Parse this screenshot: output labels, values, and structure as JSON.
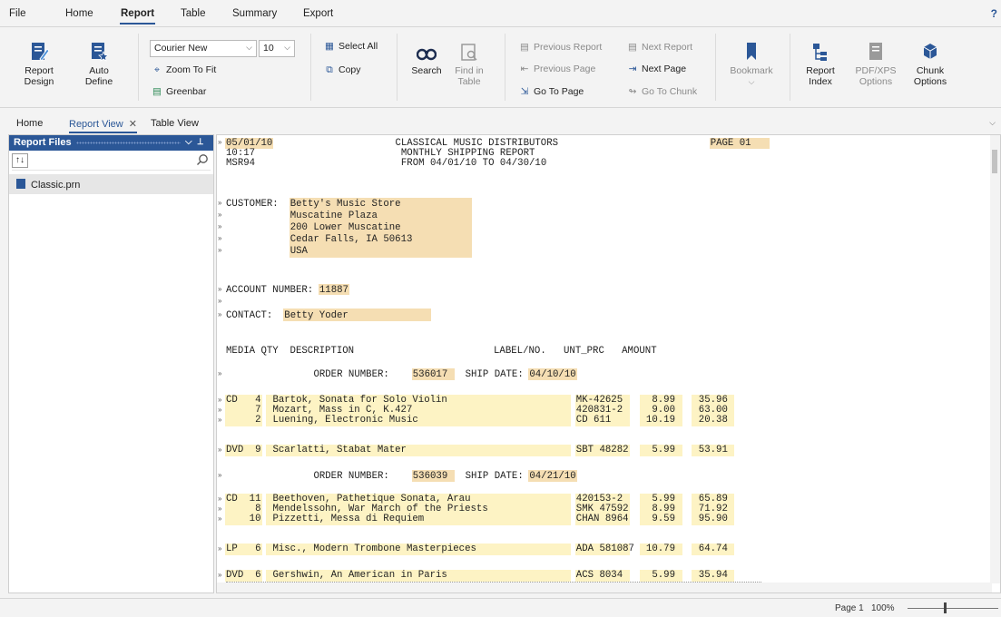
{
  "menu": {
    "items": [
      "File",
      "Home",
      "Report",
      "Table",
      "Summary",
      "Export"
    ],
    "active": "Report",
    "help": "?"
  },
  "ribbon": {
    "report_design": "Report\nDesign",
    "auto_define": "Auto\nDefine",
    "font_name": "Courier New",
    "font_size": "10",
    "zoom_to_fit": "Zoom To Fit",
    "greenbar": "Greenbar",
    "select_all": "Select All",
    "copy": "Copy",
    "search": "Search",
    "find_in_table": "Find in\nTable",
    "previous_report": "Previous Report",
    "next_report": "Next Report",
    "previous_page": "Previous Page",
    "next_page": "Next Page",
    "go_to_page": "Go To Page",
    "go_to_chunk": "Go To Chunk",
    "bookmark": "Bookmark",
    "report_index": "Report\nIndex",
    "pdf_xps": "PDF/XPS\nOptions",
    "chunk_options": "Chunk\nOptions",
    "accent": "#2b5797"
  },
  "tabs": {
    "home": "Home",
    "report_view": "Report View",
    "table_view": "Table View"
  },
  "left_panel": {
    "title": "Report Files",
    "sort_label": "↑↓",
    "file": "Classic.prn"
  },
  "report": {
    "header": {
      "date": "05/01/10",
      "company": "CLASSICAL MUSIC DISTRIBUTORS",
      "page": "PAGE 01",
      "time": "10:17",
      "report_title": "MONTHLY SHIPPING REPORT",
      "code": "MSR94",
      "range": "FROM 04/01/10 TO 04/30/10"
    },
    "customer_label": "CUSTOMER:",
    "customer": [
      "Betty's Music Store",
      "Muscatine Plaza",
      "200 Lower Muscatine",
      "Cedar Falls, IA 50613",
      "USA"
    ],
    "account_label": "ACCOUNT NUMBER:",
    "account": "11887",
    "contact_label": "CONTACT:",
    "contact": "Betty Yoder",
    "columns": "MEDIA QTY  DESCRIPTION                        LABEL/NO.   UNT_PRC   AMOUNT",
    "order_label": "ORDER NUMBER:",
    "ship_label": "SHIP DATE:",
    "orders": [
      {
        "number": "536017",
        "ship_date": "04/10/10"
      },
      {
        "number": "536039",
        "ship_date": "04/21/10"
      }
    ],
    "rows": [
      {
        "media": "CD",
        "qty": "4",
        "desc": "Bartok, Sonata for Solo Violin",
        "label": "MK-42625",
        "price": "8.99",
        "amount": "35.96"
      },
      {
        "media": "",
        "qty": "7",
        "desc": "Mozart, Mass in C, K.427",
        "label": "420831-2",
        "price": "9.00",
        "amount": "63.00"
      },
      {
        "media": "",
        "qty": "2",
        "desc": "Luening, Electronic Music",
        "label": "CD 611",
        "price": "10.19",
        "amount": "20.38"
      },
      {
        "media": "DVD",
        "qty": "9",
        "desc": "Scarlatti, Stabat Mater",
        "label": "SBT 48282",
        "price": "5.99",
        "amount": "53.91"
      },
      {
        "media": "CD",
        "qty": "11",
        "desc": "Beethoven, Pathetique Sonata, Arau",
        "label": "420153-2",
        "price": "5.99",
        "amount": "65.89"
      },
      {
        "media": "",
        "qty": "8",
        "desc": "Mendelssohn, War March of the Priests",
        "label": "SMK 47592",
        "price": "8.99",
        "amount": "71.92"
      },
      {
        "media": "",
        "qty": "10",
        "desc": "Pizzetti, Messa di Requiem",
        "label": "CHAN 8964",
        "price": "9.59",
        "amount": "95.90"
      },
      {
        "media": "LP",
        "qty": "6",
        "desc": "Misc., Modern Trombone Masterpieces",
        "label": "ADA 581087",
        "price": "10.79",
        "amount": "64.74"
      },
      {
        "media": "DVD",
        "qty": "6",
        "desc": "Gershwin, An American in Paris",
        "label": "ACS 8034",
        "price": "5.99",
        "amount": "35.94"
      }
    ]
  },
  "status": {
    "page": "Page 1",
    "zoom": "100%"
  }
}
